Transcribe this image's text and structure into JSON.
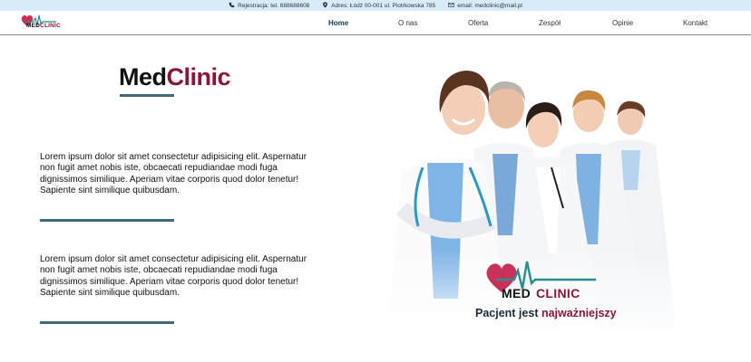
{
  "topbar": {
    "phone": "Rejestracja: tel. 688688608",
    "address": "Adres: Łódź 00-001 ul. Piotrkowska 785",
    "email": "email: medclinic@mail.pl"
  },
  "logo": {
    "part1": "MED",
    "part2": "CLINIC"
  },
  "nav": {
    "items": [
      "Home",
      "O nas",
      "Oferta",
      "Zespół",
      "Opinie",
      "Kontakt"
    ],
    "active": "Home"
  },
  "hero": {
    "title_part1": "Med",
    "title_part2": "Clinic",
    "paragraphs": [
      "Lorem ipsum dolor sit amet consectetur adipisicing elit. Aspernatur non fugit amet nobis iste, obcaecati repudiandae modi fuga dignissimos similique. Aperiam vitae corporis quod dolor tenetur! Sapiente sint similique quibusdam.",
      "Lorem ipsum dolor sit amet consectetur adipisicing elit. Aspernatur non fugit amet nobis iste, obcaecati repudiandae modi fuga dignissimos similique. Aperiam vitae corporis quod dolor tenetur! Sapiente sint similique quibusdam."
    ],
    "image_logo": {
      "part1": "MED",
      "part2": "CLINIC"
    },
    "tagline_part1": "Pacjent jest ",
    "tagline_part2": "najważniejszy"
  },
  "colors": {
    "accent": "#8b1538",
    "divider": "#3f6b78",
    "topbar_bg": "#d7ecf8",
    "pulse": "#2a8c8c"
  }
}
